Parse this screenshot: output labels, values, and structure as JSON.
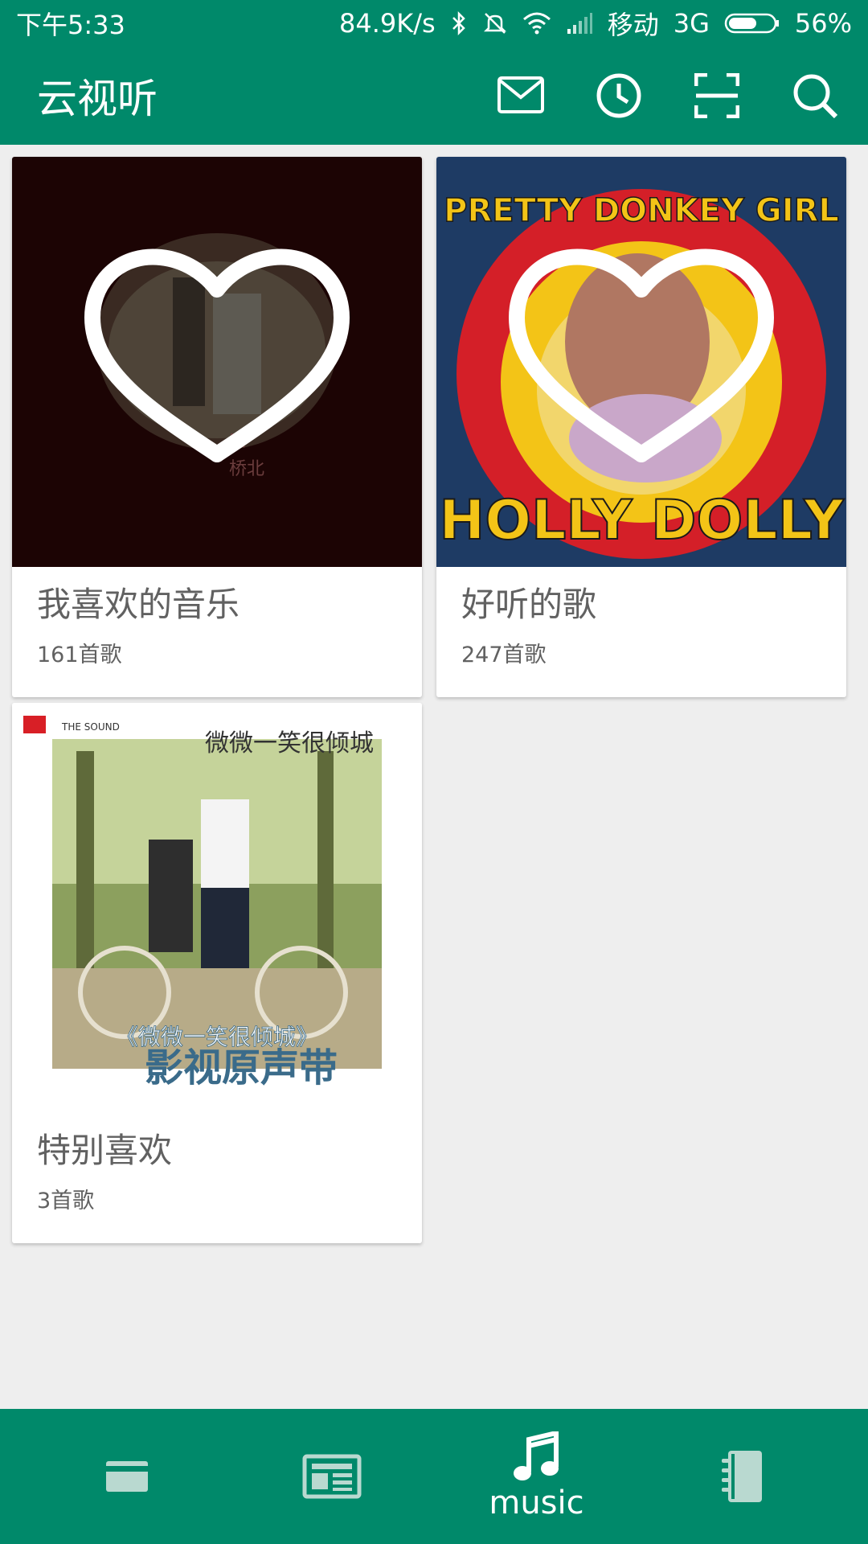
{
  "colors": {
    "primary": "#00896a",
    "background": "#eeeeee",
    "card": "#ffffff",
    "text": "#616161"
  },
  "status_bar": {
    "time": "下午5:33",
    "net_speed": "84.9K/s",
    "carrier": "移动",
    "network": "3G",
    "battery": "56%",
    "icons": [
      "bluetooth-icon",
      "mute-icon",
      "wifi-icon",
      "signal-icon",
      "battery-icon"
    ]
  },
  "app_bar": {
    "title": "云视听",
    "actions": [
      "mail-icon",
      "history-icon",
      "scan-icon",
      "search-icon"
    ]
  },
  "playlists": [
    {
      "title": "我喜欢的音乐",
      "count": "161首歌",
      "cover": "heart-over-dark-album-cover"
    },
    {
      "title": "好听的歌",
      "count": "247首歌",
      "cover": "heart-over-holly-dolly-cover"
    },
    {
      "title": "特别喜欢",
      "count": "3首歌",
      "cover": "soundtrack-album-cover"
    }
  ],
  "cover_text": {
    "card2_top": "PRETTY DONKEY GIRL",
    "card2_bottom": "HOLLY DOLLY",
    "card3_brand": "THE SOUND",
    "card3_title_top": "微微一笑很倾城",
    "card3_banner": "《微微一笑很倾城》",
    "card3_subtitle": "影视原声带"
  },
  "bottom_nav": {
    "items": [
      {
        "name": "wallet-tab",
        "icon": "card-icon"
      },
      {
        "name": "news-tab",
        "icon": "newspaper-icon"
      },
      {
        "name": "music-tab",
        "icon": "music-note-icon",
        "label": "music",
        "active": true
      },
      {
        "name": "notebook-tab",
        "icon": "notebook-icon"
      }
    ]
  }
}
